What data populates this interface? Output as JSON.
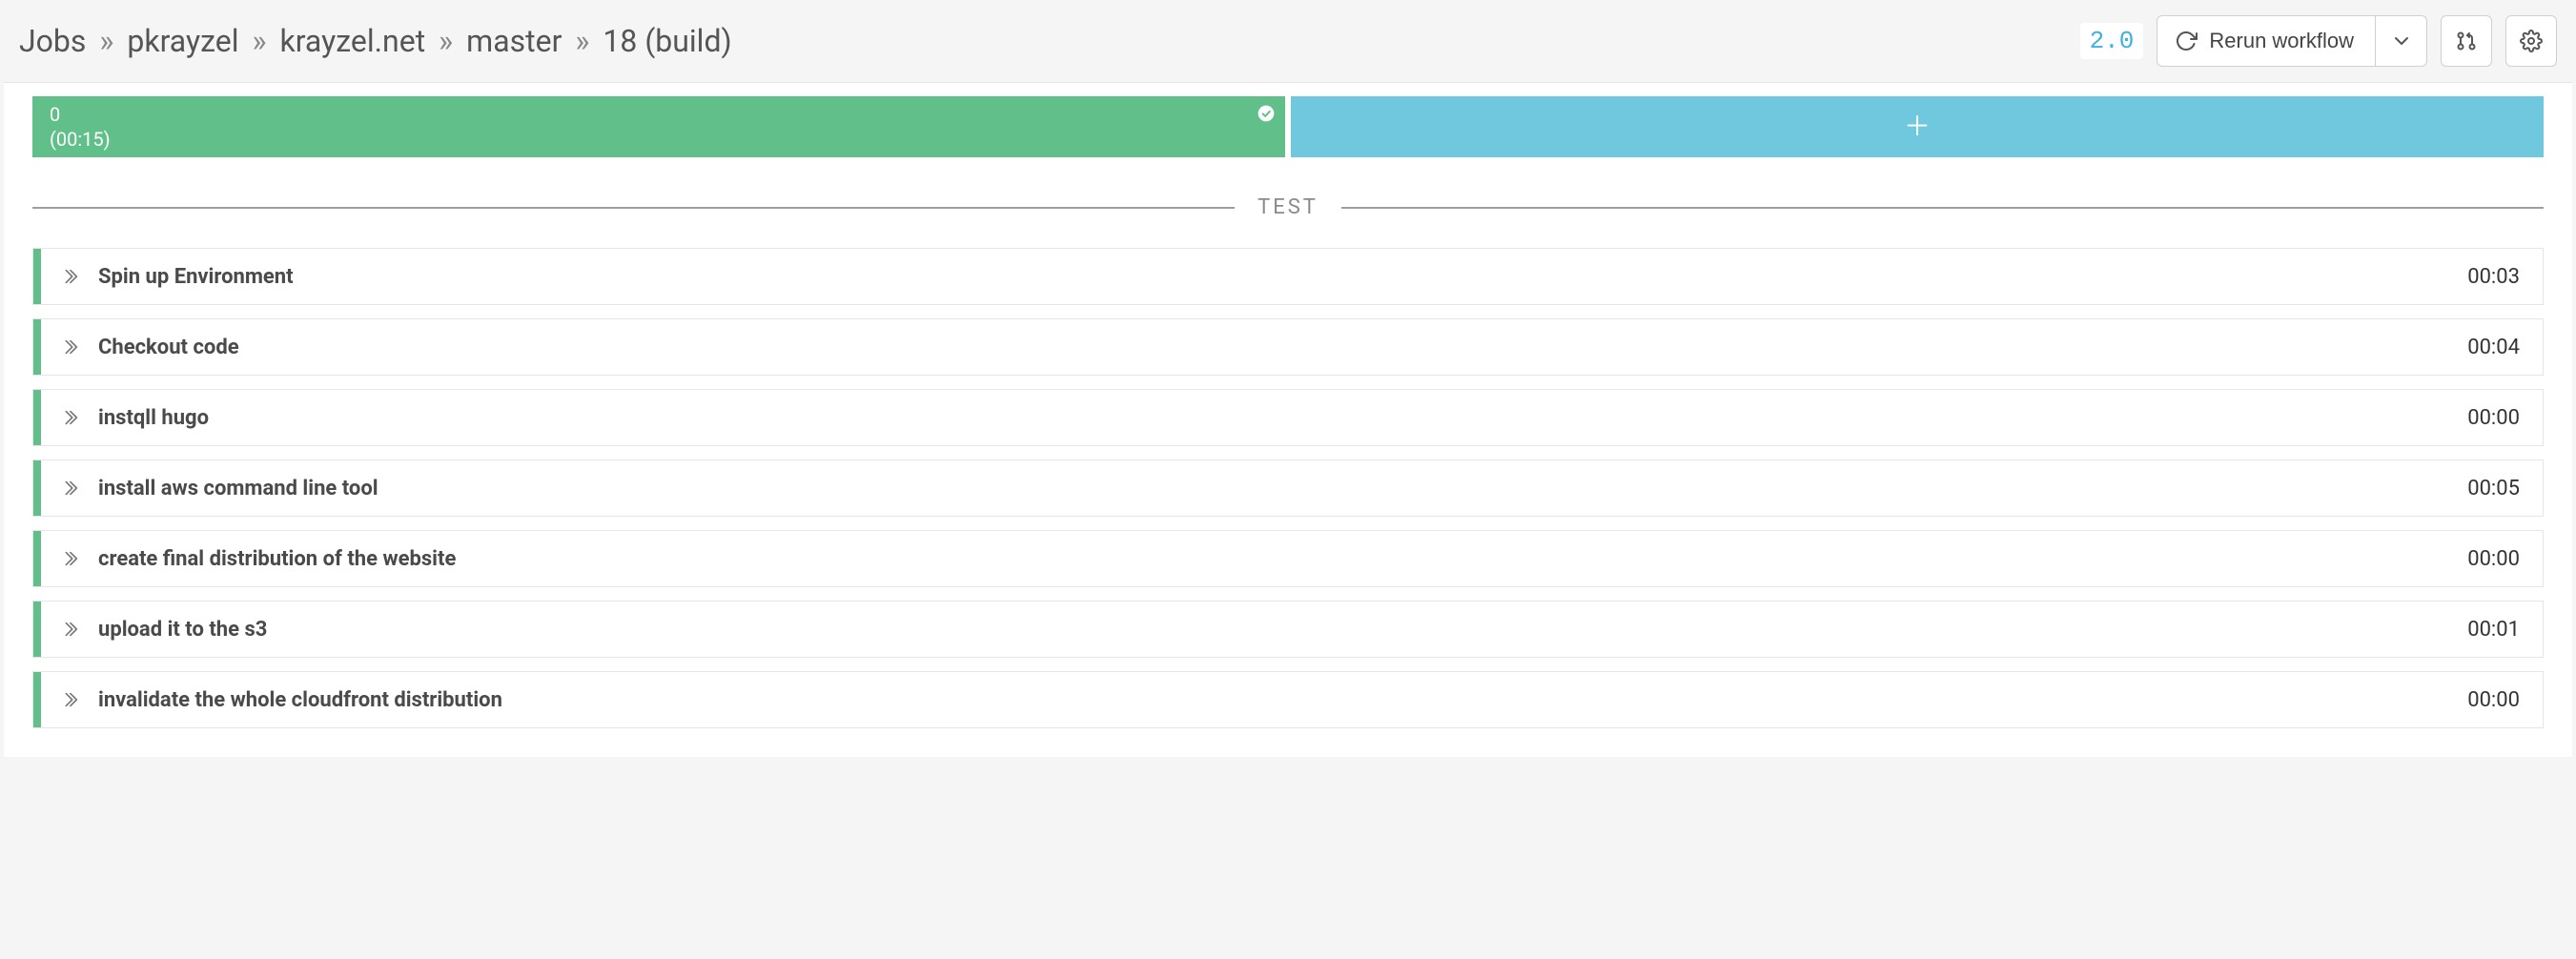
{
  "breadcrumb": {
    "root": "Jobs",
    "org": "pkrayzel",
    "repo": "krayzel.net",
    "branch": "master",
    "build": "18 (build)"
  },
  "header": {
    "version": "2.0",
    "rerun_label": "Rerun workflow"
  },
  "bars": {
    "success": {
      "index": "0",
      "duration": "(00:15)"
    }
  },
  "divider_label": "TEST",
  "steps": [
    {
      "name": "Spin up Environment",
      "time": "00:03"
    },
    {
      "name": "Checkout code",
      "time": "00:04"
    },
    {
      "name": "instqll hugo",
      "time": "00:00"
    },
    {
      "name": "install aws command line tool",
      "time": "00:05"
    },
    {
      "name": "create final distribution of the website",
      "time": "00:00"
    },
    {
      "name": "upload it to the s3",
      "time": "00:01"
    },
    {
      "name": "invalidate the whole cloudfront distribution",
      "time": "00:00"
    }
  ]
}
